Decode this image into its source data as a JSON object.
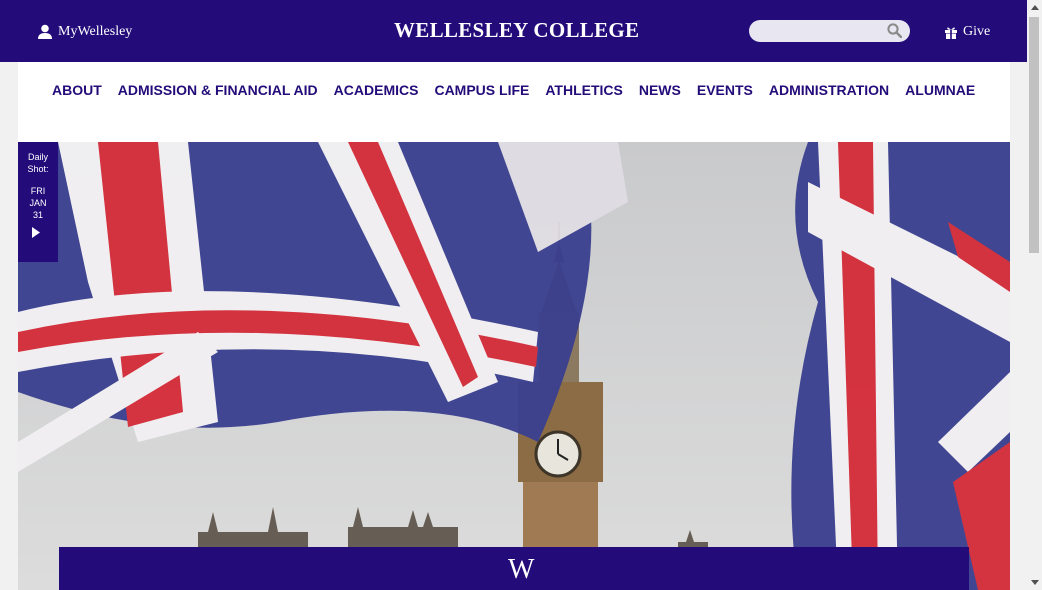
{
  "header": {
    "my_link": "MyWellesley",
    "brand": "WELLESLEY COLLEGE",
    "search_placeholder": "",
    "give_link": "Give"
  },
  "nav": {
    "items": [
      {
        "label": "ABOUT"
      },
      {
        "label": "ADMISSION & FINANCIAL AID"
      },
      {
        "label": "ACADEMICS"
      },
      {
        "label": "CAMPUS LIFE"
      },
      {
        "label": "ATHLETICS"
      },
      {
        "label": "NEWS"
      },
      {
        "label": "EVENTS"
      },
      {
        "label": "ADMINISTRATION"
      },
      {
        "label": "ALUMNAE"
      }
    ]
  },
  "daily_shot": {
    "label_1": "Daily",
    "label_2": "Shot:",
    "day": "FRI",
    "month": "JAN",
    "date": "31"
  },
  "footer_logo": "W",
  "colors": {
    "brand_purple": "#230c7a",
    "nav_text": "#230c7a"
  },
  "icons": {
    "user": "user-icon",
    "search": "search-icon",
    "gift": "gift-icon",
    "play": "play-icon"
  }
}
